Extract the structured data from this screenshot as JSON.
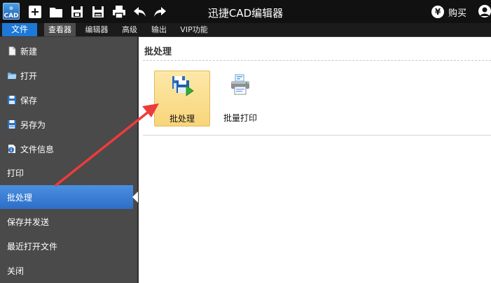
{
  "app": {
    "logo_top": "⊕",
    "logo_bottom": "CAD",
    "title": "迅捷CAD编辑器",
    "buy_label": "购买",
    "buy_symbol": "¥"
  },
  "quick_access": [
    {
      "name": "new-file-icon"
    },
    {
      "name": "open-folder-icon"
    },
    {
      "name": "save-icon"
    },
    {
      "name": "save-as-icon"
    },
    {
      "name": "print-icon"
    },
    {
      "name": "undo-icon"
    },
    {
      "name": "redo-icon"
    }
  ],
  "menu": {
    "items": [
      {
        "label": "文件"
      },
      {
        "label": "查看器"
      },
      {
        "label": "编辑器"
      },
      {
        "label": "高级"
      },
      {
        "label": "输出"
      },
      {
        "label": "VIP功能"
      }
    ]
  },
  "sidebar": {
    "items": [
      {
        "label": "新建",
        "icon": "new-document-icon"
      },
      {
        "label": "打开",
        "icon": "open-folder-icon"
      },
      {
        "label": "保存",
        "icon": "save-icon"
      },
      {
        "label": "另存为",
        "icon": "save-as-icon"
      },
      {
        "label": "文件信息",
        "icon": "info-icon"
      },
      {
        "label": "打印",
        "icon": ""
      },
      {
        "label": "批处理",
        "icon": "",
        "selected": true
      },
      {
        "label": "保存并发送",
        "icon": ""
      },
      {
        "label": "最近打开文件",
        "icon": ""
      },
      {
        "label": "关闭",
        "icon": ""
      }
    ]
  },
  "main": {
    "section_title": "批处理",
    "tools": [
      {
        "label": "批处理",
        "icon": "batch-process-icon",
        "highlighted": true
      },
      {
        "label": "批量打印",
        "icon": "batch-print-icon",
        "highlighted": false
      }
    ]
  },
  "colors": {
    "titlebar": "#111111",
    "file_tab": "#1e78d6",
    "sidebar": "#4a4a4a",
    "sidebar_selected": "#3a7fd6",
    "tool_highlight": "#f8d57a",
    "annotation_arrow": "#ee3b3b"
  }
}
